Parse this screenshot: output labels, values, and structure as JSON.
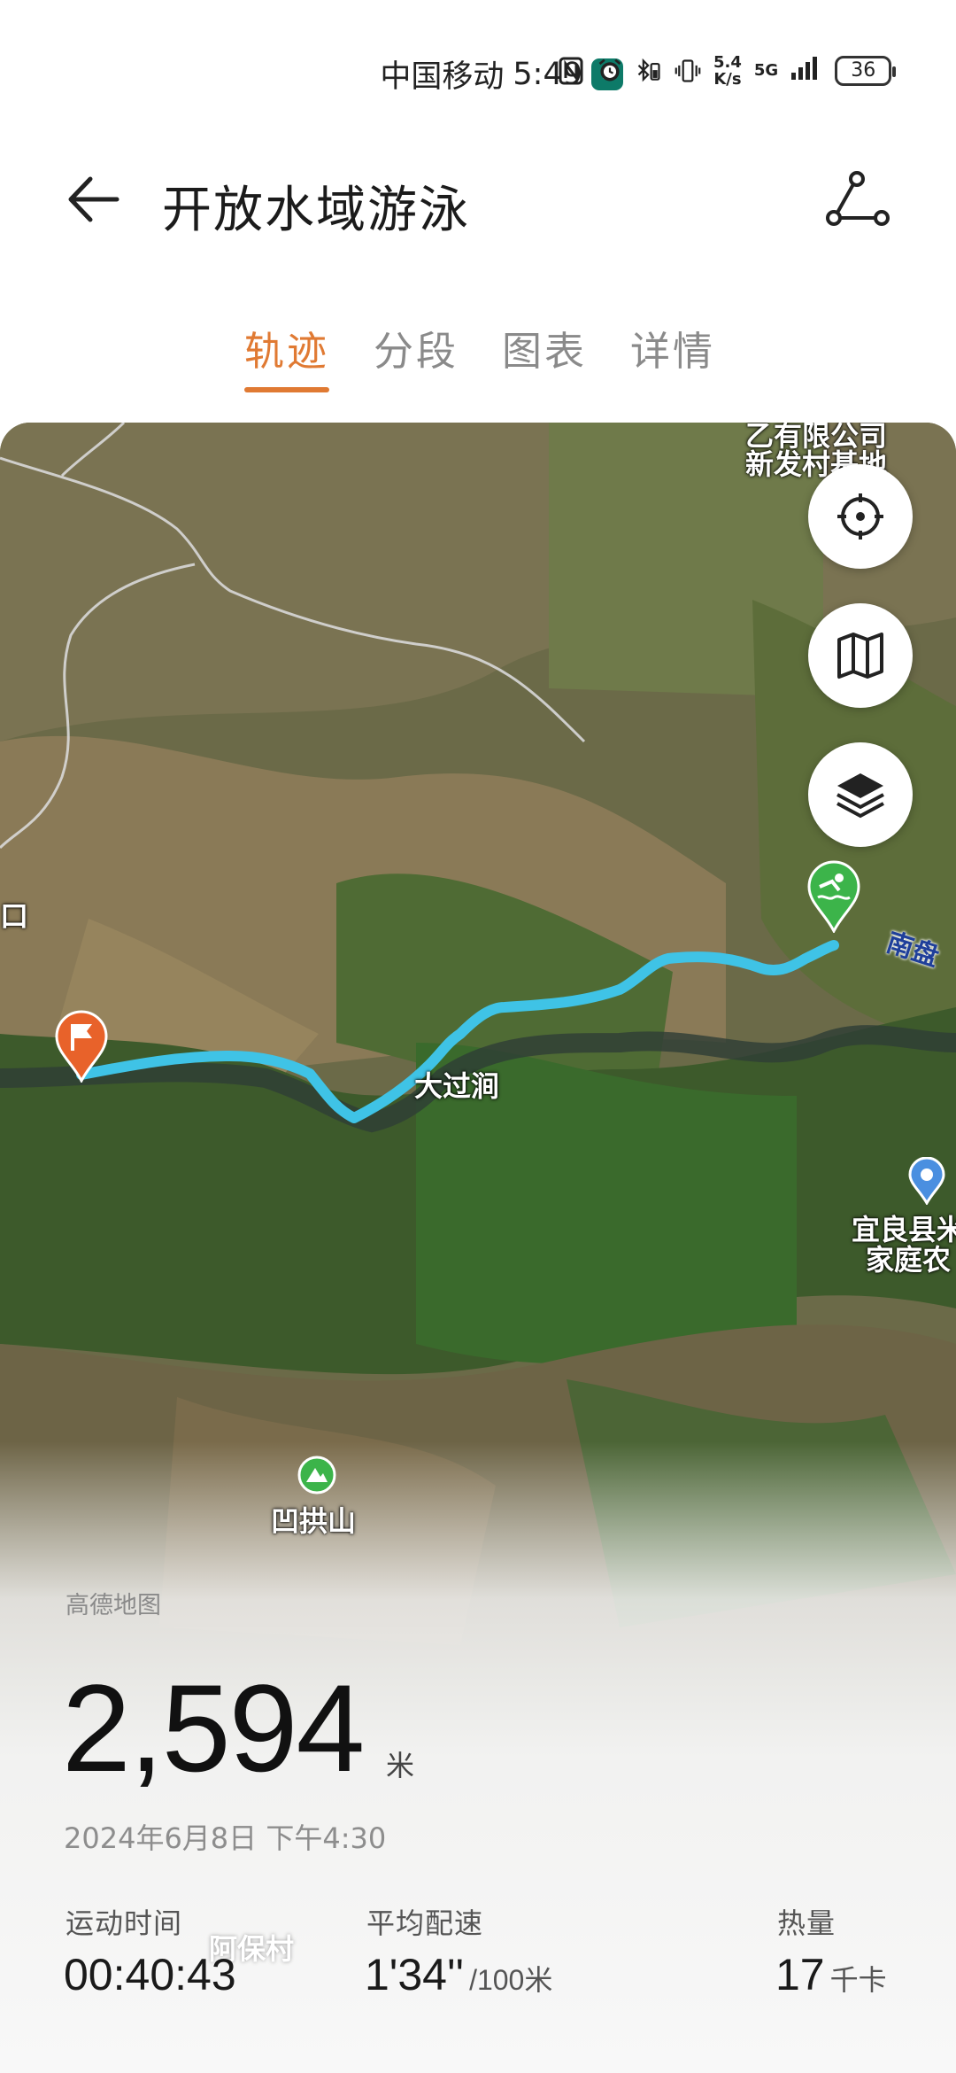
{
  "status_bar": {
    "carrier": "中国移动",
    "time": "5:49",
    "net_speed_value": "5.4",
    "net_speed_unit": "K/s",
    "network": "5G",
    "battery": "36"
  },
  "header": {
    "title": "开放水域游泳",
    "back_icon": "arrow-left-icon",
    "share_icon": "share-route-icon"
  },
  "tabs": [
    {
      "label": "轨迹",
      "active": true
    },
    {
      "label": "分段",
      "active": false
    },
    {
      "label": "图表",
      "active": false
    },
    {
      "label": "详情",
      "active": false
    }
  ],
  "map": {
    "labels": {
      "company_line1": "乙有限公司",
      "company_line2": "新发村基地",
      "village_edge": "口",
      "river_name": "南盘",
      "place_daguojian": "大过涧",
      "poi_line1": "宜良县米",
      "poi_line2": "家庭农",
      "mountain": "凹拱山",
      "village_abao": "阿保村"
    },
    "buttons": [
      "locate-icon",
      "map-type-icon",
      "layers-icon"
    ],
    "track_color": "#3fc3e6",
    "start_marker_color": "#e8622a",
    "finish_marker_color": "#3cb44a"
  },
  "stats": {
    "provider": "高德地图",
    "distance": "2,594",
    "distance_unit": "米",
    "datetime": "2024年6月8日 下午4:30",
    "duration_label": "运动时间",
    "duration_value": "00:40:43",
    "pace_label": "平均配速",
    "pace_value": "1'34''",
    "pace_unit": "/100米",
    "calories_label": "热量",
    "calories_value": "17",
    "calories_unit": "千卡"
  }
}
